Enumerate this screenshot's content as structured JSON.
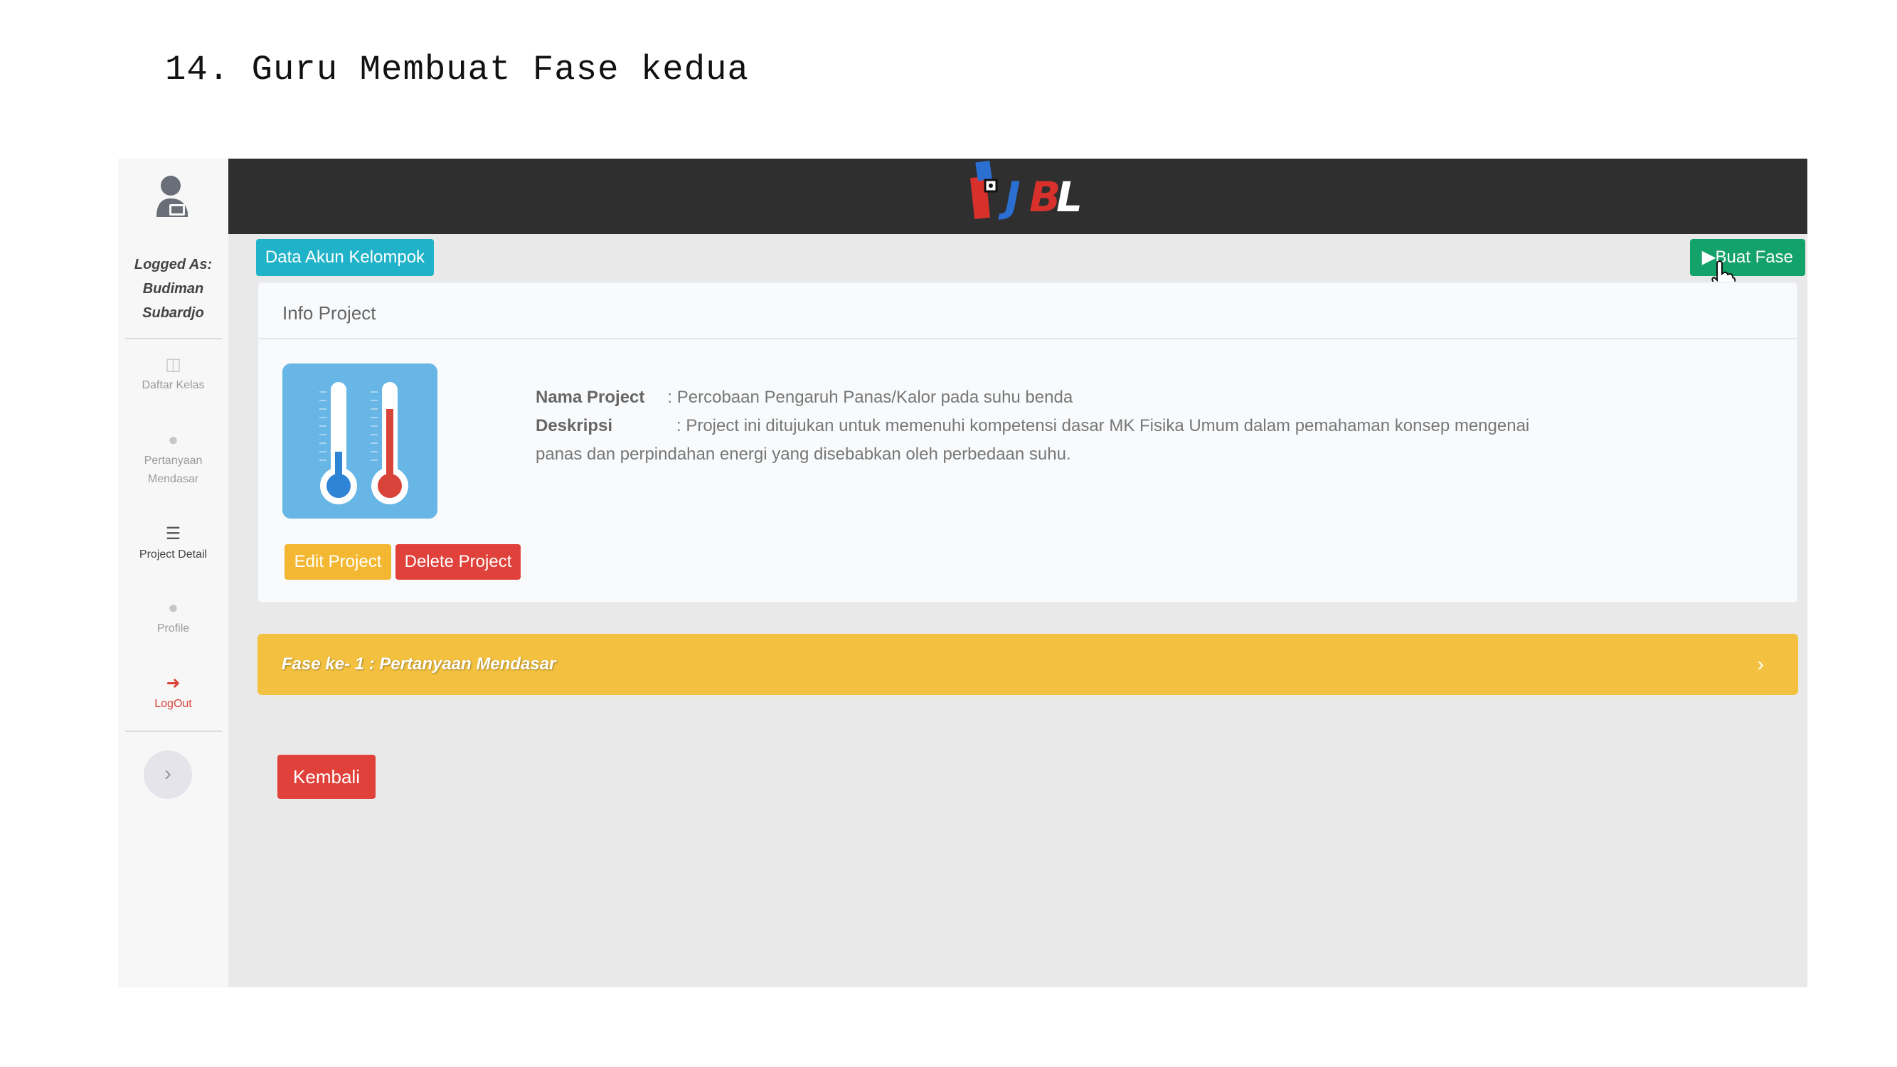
{
  "document": {
    "heading": "14. Guru Membuat Fase kedua"
  },
  "sidebar": {
    "logged_as_label": "Logged As:",
    "user_first": "Budiman",
    "user_last": "Subardjo",
    "items": [
      {
        "label": "Daftar Kelas",
        "icon": "chat-icon"
      },
      {
        "label": "Pertanyaan",
        "label2": "Mendasar",
        "icon": "question-icon"
      },
      {
        "label": "Project Detail",
        "icon": "list-icon",
        "active": true
      },
      {
        "label": "Profile",
        "icon": "user-icon"
      },
      {
        "label": "LogOut",
        "icon": "logout-icon"
      }
    ],
    "expand_icon": "chevron-right-icon"
  },
  "header": {
    "logo_text": "PjBL"
  },
  "toolbar": {
    "data_akun_label": "Data Akun Kelompok",
    "buat_fase_label": "Buat Fase"
  },
  "project_card": {
    "title": "Info Project",
    "nama_label": "Nama Project",
    "nama_value": ": Percobaan Pengaruh Panas/Kalor pada suhu benda",
    "deskripsi_label": "Deskripsi",
    "deskripsi_value_1": ": Project ini ditujukan untuk memenuhi kompetensi dasar MK Fisika Umum dalam pemahaman konsep mengenai",
    "deskripsi_value_2": "panas dan perpindahan energi yang disebabkan oleh perbedaan suhu.",
    "edit_label": "Edit Project",
    "delete_label": "Delete Project"
  },
  "phases": [
    {
      "label": "Fase ke- 1 : Pertanyaan Mendasar",
      "arrow": "›"
    }
  ],
  "footer": {
    "back_label": "Kembali"
  },
  "colors": {
    "topbar": "#2f2f2f",
    "info_button": "#1fb2c8",
    "success_button": "#14a26b",
    "warning": "#f3b731",
    "danger": "#e0413a",
    "phase_bar": "#f3c13f"
  }
}
